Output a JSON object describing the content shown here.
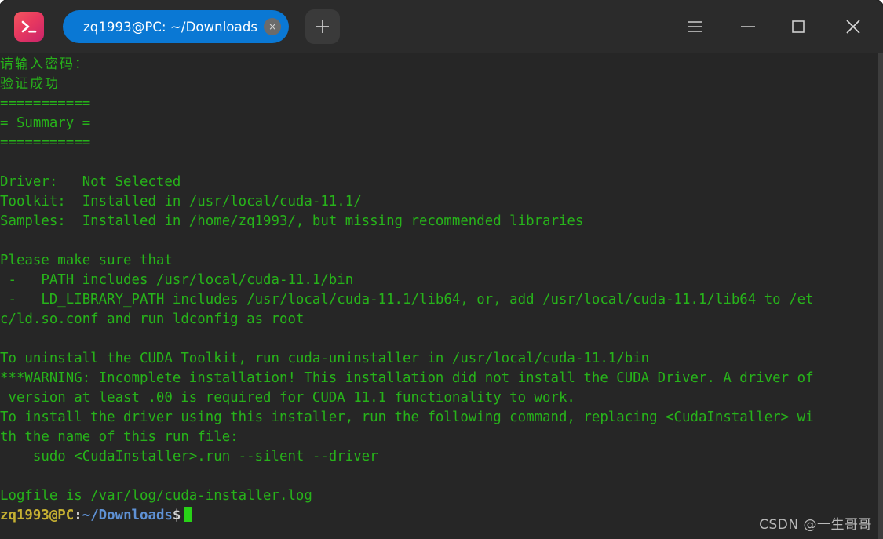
{
  "window": {
    "app_icon": "terminal-prompt-icon",
    "tab": {
      "title": "zq1993@PC: ~/Downloads",
      "close_label": "×"
    },
    "new_tab_label": "+",
    "controls": {
      "menu": "hamburger-menu-icon",
      "minimize": "minimize-icon",
      "maximize": "maximize-icon",
      "close": "close-icon"
    },
    "colors": {
      "titlebar_bg": "#2b2b2b",
      "terminal_bg": "#262626",
      "tab_active": "#0a78d4",
      "text_green": "#27b31a",
      "prompt_user": "#c5b032",
      "prompt_path": "#5f92d6",
      "cursor": "#28d217"
    }
  },
  "terminal": {
    "lines": [
      "请输入密码：",
      "验证成功",
      "===========",
      "= Summary =",
      "===========",
      "",
      "Driver:   Not Selected",
      "Toolkit:  Installed in /usr/local/cuda-11.1/",
      "Samples:  Installed in /home/zq1993/, but missing recommended libraries",
      "",
      "Please make sure that",
      " -   PATH includes /usr/local/cuda-11.1/bin",
      " -   LD_LIBRARY_PATH includes /usr/local/cuda-11.1/lib64, or, add /usr/local/cuda-11.1/lib64 to /et",
      "c/ld.so.conf and run ldconfig as root",
      "",
      "To uninstall the CUDA Toolkit, run cuda-uninstaller in /usr/local/cuda-11.1/bin",
      "***WARNING: Incomplete installation! This installation did not install the CUDA Driver. A driver of",
      " version at least .00 is required for CUDA 11.1 functionality to work.",
      "To install the driver using this installer, run the following command, replacing <CudaInstaller> wi",
      "th the name of this run file:",
      "    sudo <CudaInstaller>.run --silent --driver",
      "",
      "Logfile is /var/log/cuda-installer.log"
    ],
    "cjk_line_indexes": [
      0,
      1
    ],
    "prompt": {
      "user": "zq1993@PC",
      "colon": ":",
      "path": "~/Downloads",
      "dollar": "$"
    }
  },
  "watermark": {
    "text": "CSDN @一生哥哥"
  }
}
